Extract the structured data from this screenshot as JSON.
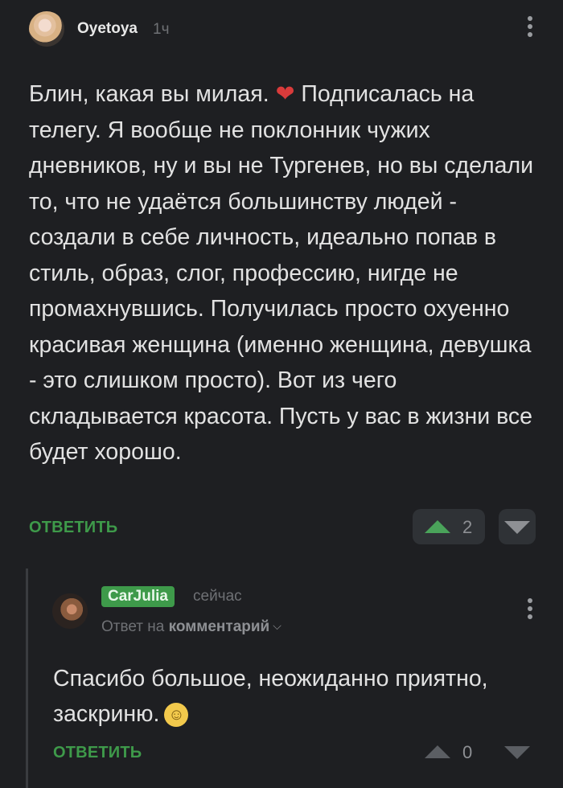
{
  "comment1": {
    "username": "Oyetoya",
    "time": "1ч",
    "text_before_heart": "Блин, какая вы милая. ",
    "heart_icon": "heart-icon",
    "text_after_heart": " Подписалась на телегу. Я вообще не поклонник чужих дневников, ну и вы не Тургенев, но вы сделали то, что не удаётся большинству людей - создали в себе личность, идеально попав в стиль, образ, слог, профессию, нигде не промахнувшись. Получилась просто охуенно красивая женщина (именно женщина, девушка - это слишком просто). Вот из чего складывается красота. Пусть у вас в жизни все будет хорошо.",
    "reply_label": "ОТВЕТИТЬ",
    "vote_count": "2"
  },
  "comment2": {
    "username": "CarJulia",
    "time": "сейчас",
    "reply_to_prefix": "Ответ на ",
    "reply_to_target": "комментарий",
    "text": "Спасибо большое, неожиданно приятно, заскриню.",
    "emoji": "☺",
    "reply_label": "ОТВЕТИТЬ",
    "vote_count": "0"
  },
  "colors": {
    "background": "#1e1f22",
    "accent_green": "#3e9a4a",
    "muted": "#6f7175"
  }
}
